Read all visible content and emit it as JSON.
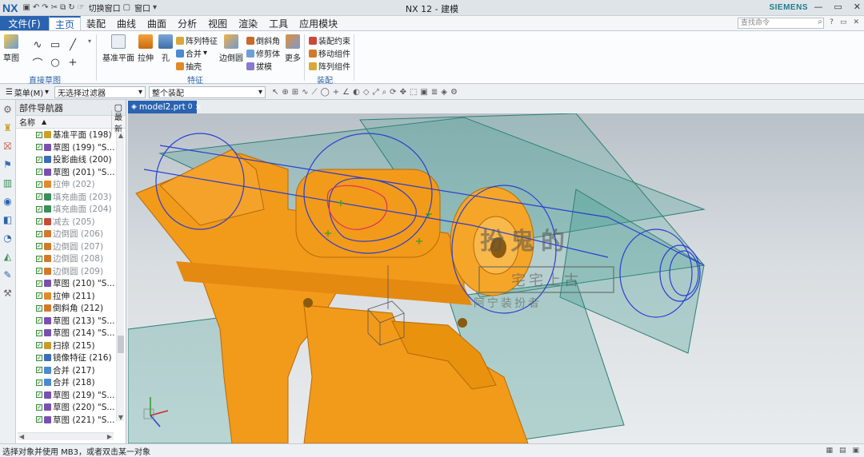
{
  "app": {
    "logo": "NX",
    "title": "NX 12 - 建模",
    "brand": "SIEMENS",
    "quick_access": {
      "switch_window": "切换窗口",
      "window": "窗口"
    }
  },
  "menu": {
    "file": "文件(F)",
    "tabs": [
      "主页",
      "装配",
      "曲线",
      "曲面",
      "分析",
      "视图",
      "渲染",
      "工具",
      "应用模块"
    ],
    "active_tab": "主页",
    "search_placeholder": "查找命令"
  },
  "ribbon": {
    "sketch": "草图",
    "direct_sketch_group": "直接草图",
    "datum_plane": "基准平面",
    "extrude": "拉伸",
    "hole": "孔",
    "pattern_feature": "阵列特征",
    "unite": "合并",
    "shell": "抽壳",
    "edge_blend": "边倒圆",
    "chamfer": "倒斜角",
    "trim_body": "修剪体",
    "draft": "拔模",
    "more": "更多",
    "feature_group": "特征",
    "assembly_constraint": "装配约束",
    "move_component": "移动组件",
    "pattern_component": "阵列组件",
    "assembly_group": "装配"
  },
  "toolbar": {
    "menu": "菜单(M)",
    "filter": "无选择过滤器",
    "scope": "整个装配"
  },
  "navigator": {
    "title": "部件导航器",
    "col_name": "名称",
    "col_recent": "最新",
    "items": [
      {
        "label": "基准平面 (198)",
        "dim": false,
        "color": "#c9a227"
      },
      {
        "label": "草图 (199) \"S...",
        "dim": false,
        "color": "#7a4fb0"
      },
      {
        "label": "投影曲线 (200)",
        "dim": false,
        "color": "#3a6fb8"
      },
      {
        "label": "草图 (201) \"S...",
        "dim": false,
        "color": "#7a4fb0"
      },
      {
        "label": "拉伸 (202)",
        "dim": true,
        "color": "#e08a2a"
      },
      {
        "label": "填充曲面 (203)",
        "dim": true,
        "color": "#3a8f5a"
      },
      {
        "label": "填充曲面 (204)",
        "dim": true,
        "color": "#3a8f5a"
      },
      {
        "label": "减去 (205)",
        "dim": true,
        "color": "#c94a3a"
      },
      {
        "label": "边倒圆 (206)",
        "dim": true,
        "color": "#d27a2a"
      },
      {
        "label": "边倒圆 (207)",
        "dim": true,
        "color": "#d27a2a"
      },
      {
        "label": "边倒圆 (208)",
        "dim": true,
        "color": "#d27a2a"
      },
      {
        "label": "边倒圆 (209)",
        "dim": true,
        "color": "#d27a2a"
      },
      {
        "label": "草图 (210) \"S...",
        "dim": false,
        "color": "#7a4fb0"
      },
      {
        "label": "拉伸 (211)",
        "dim": false,
        "color": "#e08a2a"
      },
      {
        "label": "倒斜角 (212)",
        "dim": false,
        "color": "#d27a2a"
      },
      {
        "label": "草图 (213) \"S...",
        "dim": false,
        "color": "#7a4fb0"
      },
      {
        "label": "草图 (214) \"S...",
        "dim": false,
        "color": "#7a4fb0"
      },
      {
        "label": "扫掠 (215)",
        "dim": false,
        "color": "#c99b2a"
      },
      {
        "label": "镜像特征 (216)",
        "dim": false,
        "color": "#3a6fb8"
      },
      {
        "label": "合并 (217)",
        "dim": false,
        "color": "#4a8ad0"
      },
      {
        "label": "合并 (218)",
        "dim": false,
        "color": "#4a8ad0"
      },
      {
        "label": "草图 (219) \"S...",
        "dim": false,
        "color": "#7a4fb0"
      },
      {
        "label": "草图 (220) \"S...",
        "dim": false,
        "color": "#7a4fb0"
      },
      {
        "label": "草图 (221) \"S...",
        "dim": false,
        "color": "#7a4fb0"
      }
    ]
  },
  "document_tab": {
    "label": "model2.prt",
    "modified_mark": "0",
    "close": "×"
  },
  "watermark": {
    "line1": "扮鬼的",
    "line2": "宅宅上古",
    "line3": "阿宁装扮者"
  },
  "status": {
    "text": "选择对象并使用 MB3，或者双击某一对象"
  },
  "colors": {
    "accent": "#2a63b0",
    "body": "#f29a1a",
    "plane": "#3d9a8e",
    "curve": "#2a3fd0"
  }
}
